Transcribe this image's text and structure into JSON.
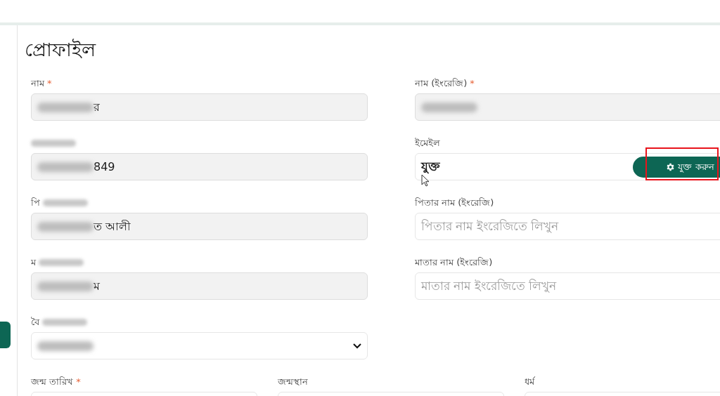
{
  "title": "প্রোফাইল",
  "rows": [
    {
      "kind": "pair",
      "fields": [
        {
          "kind": "text",
          "label": "নাম",
          "required_mark": "*",
          "value": "র",
          "value_blurred": true,
          "readonly": true
        },
        {
          "kind": "text",
          "label": "নাম (ইংরেজি)",
          "required_mark": "*",
          "value_blurred": true,
          "readonly": true
        }
      ]
    },
    {
      "kind": "pair",
      "fields": [
        {
          "kind": "text",
          "label_blurred": true,
          "value": "849",
          "value_blurred": true,
          "readonly": true
        },
        {
          "kind": "email",
          "label": "ইমেইল",
          "value": "যুক্ত",
          "readonly": false,
          "action": {
            "label": "যুক্ত করুন",
            "highlighted": true
          }
        }
      ]
    },
    {
      "kind": "pair",
      "fields": [
        {
          "kind": "text",
          "label": "পি",
          "label_blurred": true,
          "value": "ত আলী",
          "value_blurred": true,
          "readonly": true
        },
        {
          "kind": "text",
          "label": "পিতার নাম (ইংরেজি)",
          "placeholder": "পিতার নাম ইংরেজিতে লিখুন",
          "readonly": false
        }
      ]
    },
    {
      "kind": "pair",
      "fields": [
        {
          "kind": "text",
          "label": "ম",
          "label_blurred": true,
          "value": "ম",
          "value_blurred": true,
          "readonly": true
        },
        {
          "kind": "text",
          "label": "মাতার নাম (ইংরেজি)",
          "placeholder": "মাতার নাম ইংরেজিতে লিখুন",
          "readonly": false
        }
      ]
    },
    {
      "kind": "pair",
      "fields": [
        {
          "kind": "select",
          "label": "বৈ",
          "label_blurred": true,
          "value_blurred": true,
          "readonly": false
        }
      ]
    },
    {
      "kind": "triple",
      "fields": [
        {
          "kind": "text",
          "label": "জন্ম তারিখ",
          "required_mark": "*",
          "readonly": false
        },
        {
          "kind": "text",
          "label": "জন্মস্থান",
          "readonly": false
        },
        {
          "kind": "text",
          "label": "ধর্ম",
          "readonly": false
        }
      ]
    }
  ]
}
